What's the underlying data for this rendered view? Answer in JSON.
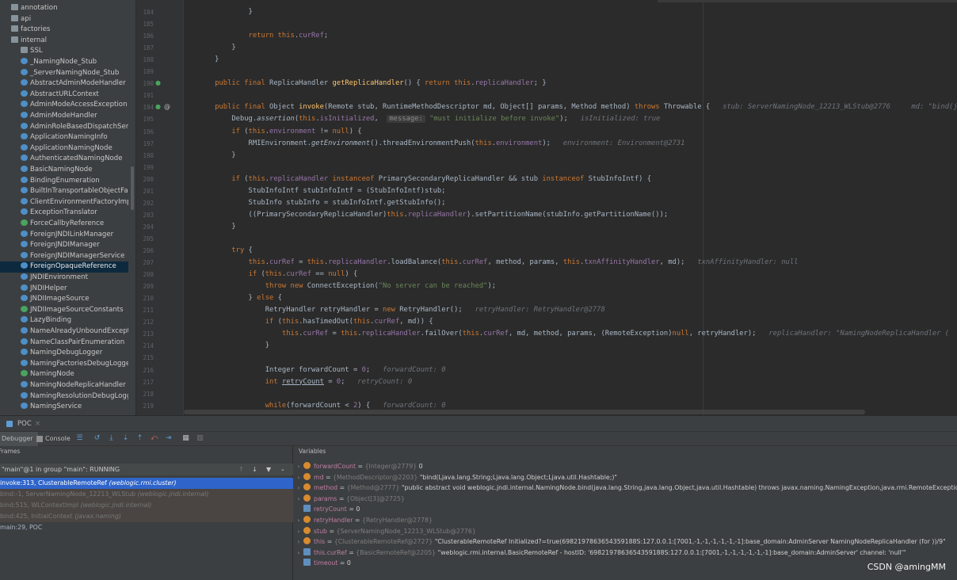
{
  "project_tree": {
    "items": [
      {
        "label": "annotation",
        "kind": "folder",
        "indent": 1,
        "arrow": ">"
      },
      {
        "label": "api",
        "kind": "folder",
        "indent": 1,
        "arrow": ">"
      },
      {
        "label": "factories",
        "kind": "folder",
        "indent": 1,
        "arrow": ">"
      },
      {
        "label": "internal",
        "kind": "folder",
        "indent": 1,
        "arrow": "v"
      },
      {
        "label": "SSL",
        "kind": "folder",
        "indent": 2,
        "arrow": ">"
      },
      {
        "label": "_NamingNode_Stub",
        "kind": "class",
        "indent": 2,
        "arrow": ""
      },
      {
        "label": "_ServerNamingNode_Stub",
        "kind": "class",
        "indent": 2,
        "arrow": ""
      },
      {
        "label": "AbstractAdminModeHandler",
        "kind": "class",
        "indent": 2,
        "arrow": ""
      },
      {
        "label": "AbstractURLContext",
        "kind": "class",
        "indent": 2,
        "arrow": ""
      },
      {
        "label": "AdminModeAccessException",
        "kind": "class",
        "indent": 2,
        "arrow": ""
      },
      {
        "label": "AdminModeHandler",
        "kind": "class",
        "indent": 2,
        "arrow": ">"
      },
      {
        "label": "AdminRoleBasedDispatchServ",
        "kind": "class",
        "indent": 2,
        "arrow": ""
      },
      {
        "label": "ApplicationNamingInfo",
        "kind": "class",
        "indent": 2,
        "arrow": ""
      },
      {
        "label": "ApplicationNamingNode",
        "kind": "class",
        "indent": 2,
        "arrow": ">"
      },
      {
        "label": "AuthenticatedNamingNode",
        "kind": "class",
        "indent": 2,
        "arrow": ""
      },
      {
        "label": "BasicNamingNode",
        "kind": "class",
        "indent": 2,
        "arrow": ""
      },
      {
        "label": "BindingEnumeration",
        "kind": "class",
        "indent": 2,
        "arrow": ""
      },
      {
        "label": "BuiltInTransportableObjectFa",
        "kind": "class",
        "indent": 2,
        "arrow": ""
      },
      {
        "label": "ClientEnvironmentFactoryImpl",
        "kind": "class",
        "indent": 2,
        "arrow": ""
      },
      {
        "label": "ExceptionTranslator",
        "kind": "class",
        "indent": 2,
        "arrow": ""
      },
      {
        "label": "ForceCallbyReference",
        "kind": "class-g",
        "indent": 2,
        "arrow": ""
      },
      {
        "label": "ForeignJNDILinkManager",
        "kind": "class",
        "indent": 2,
        "arrow": ""
      },
      {
        "label": "ForeignJNDIManager",
        "kind": "class",
        "indent": 2,
        "arrow": ">"
      },
      {
        "label": "ForeignJNDIManagerService",
        "kind": "class",
        "indent": 2,
        "arrow": ">"
      },
      {
        "label": "ForeignOpaqueReference",
        "kind": "class",
        "indent": 2,
        "arrow": "",
        "selected": true
      },
      {
        "label": "JNDIEnvironment",
        "kind": "class",
        "indent": 2,
        "arrow": ">"
      },
      {
        "label": "JNDIHelper",
        "kind": "class",
        "indent": 2,
        "arrow": ">"
      },
      {
        "label": "JNDIImageSource",
        "kind": "class",
        "indent": 2,
        "arrow": ">"
      },
      {
        "label": "JNDIImageSourceConstants",
        "kind": "class-g",
        "indent": 2,
        "arrow": ""
      },
      {
        "label": "LazyBinding",
        "kind": "class",
        "indent": 2,
        "arrow": ""
      },
      {
        "label": "NameAlreadyUnboundExcepti",
        "kind": "class",
        "indent": 2,
        "arrow": ""
      },
      {
        "label": "NameClassPairEnumeration",
        "kind": "class",
        "indent": 2,
        "arrow": ""
      },
      {
        "label": "NamingDebugLogger",
        "kind": "class",
        "indent": 2,
        "arrow": ""
      },
      {
        "label": "NamingFactoriesDebugLogge",
        "kind": "class",
        "indent": 2,
        "arrow": ""
      },
      {
        "label": "NamingNode",
        "kind": "class-g",
        "indent": 2,
        "arrow": ""
      },
      {
        "label": "NamingNodeReplicaHandler",
        "kind": "class",
        "indent": 2,
        "arrow": ""
      },
      {
        "label": "NamingResolutionDebugLogg",
        "kind": "class",
        "indent": 2,
        "arrow": ""
      },
      {
        "label": "NamingService",
        "kind": "class",
        "indent": 2,
        "arrow": ">"
      }
    ]
  },
  "editor": {
    "line_numbers": [
      "184",
      "185",
      "186",
      "187",
      "188",
      "189",
      "190",
      "191",
      "194",
      "195",
      "196",
      "197",
      "198",
      "199",
      "200",
      "201",
      "202",
      "203",
      "204",
      "205",
      "206",
      "207",
      "208",
      "209",
      "210",
      "211",
      "212",
      "213",
      "214",
      "215",
      "216",
      "217",
      "218",
      "219"
    ],
    "lines": [
      {
        "html": "            }"
      },
      {
        "html": ""
      },
      {
        "html": "            <span class=\"kw\">return this</span>.<span class=\"fld\">curRef</span>;"
      },
      {
        "html": "        }"
      },
      {
        "html": "    }"
      },
      {
        "html": ""
      },
      {
        "html": "    <span class=\"kw\">public final</span> ReplicaHandler <span class=\"mth\">getReplicaHandler</span>() { <span class=\"kw\">return this</span>.<span class=\"fld\">replicaHandler</span>; }"
      },
      {
        "html": ""
      },
      {
        "html": "    <span class=\"kw\">public final</span> Object <span class=\"mth\">invoke</span>(Remote stub, RuntimeMethodDescriptor md, Object[] params, Method method) <span class=\"kw\">throws</span> Throwable {   <span class=\"hint\">stub: ServerNamingNode_12213_WLStub@2776     md: \"bind(j</span>"
      },
      {
        "html": "        Debug.<span class=\"it\">assertion</span>(<span class=\"kw\">this</span>.<span class=\"fld\">isInitialized</span>,  <span class=\"chip\">message:</span> <span class=\"str\">\"must initialize before invoke\"</span>);   <span class=\"hint\">isInitialized: true</span>"
      },
      {
        "html": "        <span class=\"kw\">if</span> (<span class=\"kw\">this</span>.<span class=\"fld\">environment</span> != <span class=\"kw\">null</span>) {"
      },
      {
        "html": "            RMIEnvironment.<span class=\"it\">getEnvironment</span>().threadEnvironmentPush(<span class=\"kw\">this</span>.<span class=\"fld\">environment</span>);   <span class=\"hint\">environment: Environment@2731</span>"
      },
      {
        "html": "        }"
      },
      {
        "html": ""
      },
      {
        "html": "        <span class=\"kw\">if</span> (<span class=\"kw\">this</span>.<span class=\"fld\">replicaHandler</span> <span class=\"kw\">instanceof</span> PrimarySecondaryReplicaHandler &amp;&amp; stub <span class=\"kw\">instanceof</span> StubInfoIntf) {"
      },
      {
        "html": "            StubInfoIntf stubInfoIntf = (StubInfoIntf)stub;"
      },
      {
        "html": "            StubInfo stubInfo = stubInfoIntf.getStubInfo();"
      },
      {
        "html": "            ((PrimarySecondaryReplicaHandler)<span class=\"kw\">this</span>.<span class=\"fld\">replicaHandler</span>).setPartitionName(stubInfo.getPartitionName());"
      },
      {
        "html": "        }"
      },
      {
        "html": ""
      },
      {
        "html": "        <span class=\"kw\">try</span> {"
      },
      {
        "html": "            <span class=\"kw\">this</span>.<span class=\"fld\">curRef</span> = <span class=\"kw\">this</span>.<span class=\"fld\">replicaHandler</span>.loadBalance(<span class=\"kw\">this</span>.<span class=\"fld\">curRef</span>, method, params, <span class=\"kw\">this</span>.<span class=\"fld\">txnAffinityHandler</span>, md);   <span class=\"hint\">txnAffinityHandler: null</span>"
      },
      {
        "html": "            <span class=\"kw\">if</span> (<span class=\"kw\">this</span>.<span class=\"fld\">curRef</span> == <span class=\"kw\">null</span>) {"
      },
      {
        "html": "                <span class=\"kw\">throw new</span> ConnectException(<span class=\"str\">\"No server can be reached\"</span>);"
      },
      {
        "html": "            } <span class=\"kw\">else</span> {"
      },
      {
        "html": "                RetryHandler retryHandler = <span class=\"kw\">new</span> RetryHandler();   <span class=\"hint\">retryHandler: RetryHandler@2778</span>"
      },
      {
        "html": "                <span class=\"kw\">if</span> (<span class=\"kw\">this</span>.hasTimedOut(<span class=\"kw\">this</span>.<span class=\"fld\">curRef</span>, md)) {"
      },
      {
        "html": "                    <span class=\"kw\">this</span>.<span class=\"fld\">curRef</span> = <span class=\"kw\">this</span>.<span class=\"fld\">replicaHandler</span>.failOver(<span class=\"kw\">this</span>.<span class=\"fld\">curRef</span>, md, method, params, (RemoteException)<span class=\"kw\">null</span>, retryHandler);   <span class=\"hint\">replicaHandler: \"NamingNodeReplicaHandler (</span>"
      },
      {
        "html": "                }"
      },
      {
        "html": ""
      },
      {
        "html": "                Integer forwardCount = <span class=\"fld\">0</span>;   <span class=\"hint\">forwardCount: 0</span>"
      },
      {
        "html": "                <span class=\"kw\">int</span> <span class=\"ul\">retryCount</span> = <span class=\"fld\">0</span>;   <span class=\"hint\">retryCount: 0</span>"
      },
      {
        "html": ""
      },
      {
        "html": "                <span class=\"kw\">while</span>(forwardCount &lt; <span class=\"fld\">2</span>) {   <span class=\"hint\">forwardCount: 0</span>"
      }
    ]
  },
  "debug": {
    "config_name": "POC",
    "tab_debugger": "Debugger",
    "tab_console": "Console",
    "frames_header": "Frames",
    "variables_header": "Variables",
    "thread": "\"main\"@1 in group \"main\": RUNNING",
    "frames": [
      {
        "text": "invoke:313, ClusterableRemoteRef ",
        "pkg": "(weblogic.rmi.cluster)",
        "state": "sel"
      },
      {
        "text": "bind:-1, ServerNamingNode_12213_WLStub ",
        "pkg": "(weblogic.jndi.internal)",
        "state": "dim"
      },
      {
        "text": "bind:515, WLContextImpl ",
        "pkg": "(weblogic.jndi.internal)",
        "state": "dim"
      },
      {
        "text": "bind:425, InitialContext ",
        "pkg": "(javax.naming)",
        "state": "dim"
      },
      {
        "text": "main:29, POC",
        "pkg": "",
        "state": ""
      }
    ],
    "variables": [
      {
        "exp": ">",
        "icon": "p",
        "name": "forwardCount",
        "type": "{Integer@2779}",
        "value": "0"
      },
      {
        "exp": ">",
        "icon": "p",
        "name": "md",
        "type": "{MethodDescriptor@2203}",
        "value": "\"bind(Ljava.lang.String;Ljava.lang.Object;Ljava.util.Hashtable;)\""
      },
      {
        "exp": ">",
        "icon": "p",
        "name": "method",
        "type": "{Method@2777}",
        "value": "\"public abstract void weblogic.jndi.internal.NamingNode.bind(java.lang.String,java.lang.Object,java.util.Hashtable) throws javax.naming.NamingException,java.rmi.RemoteException\""
      },
      {
        "exp": ">",
        "icon": "p",
        "name": "params",
        "type": "{Object[3]@2725}",
        "value": ""
      },
      {
        "exp": "",
        "icon": "f",
        "name": "retryCount",
        "type": "",
        "value": "0"
      },
      {
        "exp": ">",
        "icon": "p",
        "name": "retryHandler",
        "type": "{RetryHandler@2778}",
        "value": ""
      },
      {
        "exp": ">",
        "icon": "p",
        "name": "stub",
        "type": "{ServerNamingNode_12213_WLStub@2776}",
        "value": ""
      },
      {
        "exp": ">",
        "icon": "p",
        "name": "this",
        "type": "{ClusterableRemoteRef@2727}",
        "value": "\"ClusterableRemoteRef Initialized?=true(6982197863654359188S:127.0.0.1:[7001,-1,-1,-1,-1,-1,-1]:base_domain:AdminServer NamingNodeReplicaHandler (for ))/9\""
      },
      {
        "exp": ">",
        "icon": "f",
        "name": "this.curRef",
        "type": "{BasicRemoteRef@2205}",
        "value": "\"weblogic.rmi.internal.BasicRemoteRef - hostID: '6982197863654359188S:127.0.0.1:[7001,-1,-1,-1,-1,-1,-1]:base_domain:AdminServer' channel: 'null'\""
      },
      {
        "exp": "",
        "icon": "f",
        "name": "timeout",
        "type": "",
        "value": "0"
      }
    ]
  },
  "watermark": "CSDN @amingMM"
}
